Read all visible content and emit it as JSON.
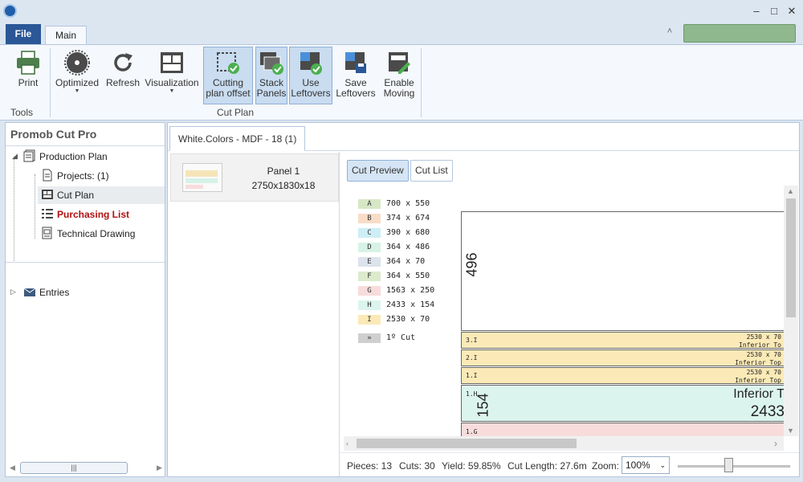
{
  "ribbon_tabs": {
    "file": "File",
    "main": "Main"
  },
  "ribbon": {
    "tools_group": "Tools",
    "cutplan_group": "Cut Plan",
    "print": "Print",
    "optimized": "Optimized",
    "refresh": "Refresh",
    "visualization": "Visualization",
    "cutting_offset": [
      "Cutting",
      "plan offset"
    ],
    "stack_panels": [
      "Stack",
      "Panels"
    ],
    "use_leftovers": [
      "Use",
      "Leftovers"
    ],
    "save_leftovers": [
      "Save",
      "Leftovers"
    ],
    "enable_moving": [
      "Enable",
      "Moving"
    ],
    "accent": "#2b5797",
    "status_color": "#8fb88f"
  },
  "nav": {
    "title": "Promob Cut Pro",
    "items": [
      {
        "label": "Production Plan",
        "icon": "production-plan-icon"
      },
      {
        "label": "Projects: (1)",
        "icon": "document-icon"
      },
      {
        "label": "Cut Plan",
        "icon": "cut-plan-icon"
      },
      {
        "label": "Purchasing List",
        "icon": "list-icon",
        "color": "#b01010"
      },
      {
        "label": "Technical Drawing",
        "icon": "technical-drawing-icon"
      },
      {
        "label": "Entries",
        "icon": "entries-icon"
      }
    ]
  },
  "doc_tab": "White.Colors - MDF - 18 (1)",
  "panel": {
    "name": "Panel 1",
    "dims": "2750x1830x18"
  },
  "views": {
    "preview": "Cut Preview",
    "list": "Cut List"
  },
  "legend": [
    {
      "key": "A",
      "dims": "700 x 550",
      "color": "#d7e7c6"
    },
    {
      "key": "B",
      "dims": "374 x 674",
      "color": "#f9dcc8"
    },
    {
      "key": "C",
      "dims": "390 x 680",
      "color": "#cdeef5"
    },
    {
      "key": "D",
      "dims": "364 x 486",
      "color": "#d7f2e6"
    },
    {
      "key": "E",
      "dims": "364 x 70",
      "color": "#dde3ec"
    },
    {
      "key": "F",
      "dims": "364 x 550",
      "color": "#dcebcc"
    },
    {
      "key": "G",
      "dims": "1563 x 250",
      "color": "#f8dcdc"
    },
    {
      "key": "H",
      "dims": "2433 x 154",
      "color": "#dcf4ee"
    },
    {
      "key": "I",
      "dims": "2530 x 70",
      "color": "#fbeab7"
    }
  ],
  "first_cut": {
    "key": "»",
    "label": "1º Cut",
    "color": "#cfcfcf"
  },
  "drawing": {
    "top_value": "496",
    "strips": [
      {
        "label": "3.I",
        "dim": "2530 x 70",
        "name": "Inferior To",
        "color": "#fbeab7"
      },
      {
        "label": "2.I",
        "dim": "2530 x 70",
        "name": "Inferior Top",
        "color": "#fbeab7"
      },
      {
        "label": "1.I",
        "dim": "2530 x 70",
        "name": "Inferior Top",
        "color": "#fbeab7"
      }
    ],
    "h_strip": {
      "label": "1.H",
      "name": "Inferior T",
      "value": "2433",
      "side_value": "154",
      "color": "#dcf4ee"
    },
    "g_strip": {
      "label": "1.G",
      "color": "#f8dcdc"
    }
  },
  "status": {
    "pieces": "Pieces: 13",
    "cuts": "Cuts: 30",
    "yield": "Yield: 59.85%",
    "cut_length": "Cut Length: 27.6m",
    "zoom_label": "Zoom:",
    "zoom_value": "100%",
    "zoom_fraction": 0.45
  }
}
